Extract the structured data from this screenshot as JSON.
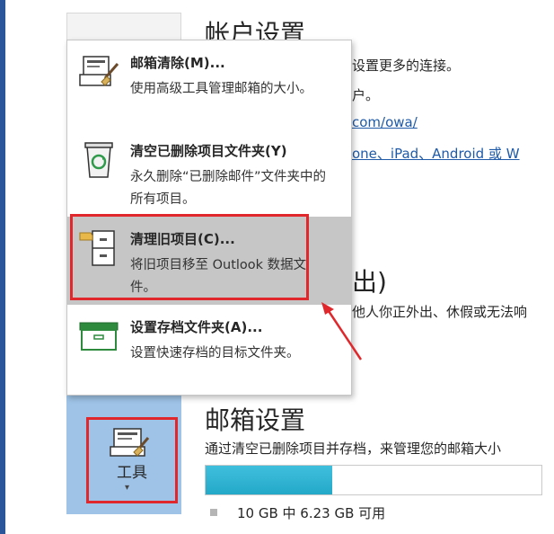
{
  "page": {
    "account_settings_title": "帐户设置",
    "account_lines": [
      "设置更多的连接。",
      "户。"
    ],
    "owa_link": "com/owa/",
    "devices_link": "one、iPad、Android 或 W",
    "auto_reply_title_fragment": "出)",
    "auto_reply_desc_fragment": "他人你正外出、休假或无法响",
    "mailbox_settings_title": "邮箱设置",
    "mailbox_settings_desc": "通过清空已删除项目并存档，来管理您的邮箱大小",
    "storage_text": "10 GB 中 6.23 GB 可用",
    "storage_fraction": 0.377,
    "tools_button_label": "工具"
  },
  "menu": {
    "items": [
      {
        "title": "邮箱清除(M)...",
        "desc": "使用高级工具管理邮箱的大小。",
        "icon": "mailbox-cleanup-icon"
      },
      {
        "title": "清空已删除项目文件夹(Y)",
        "desc": "永久删除“已删除邮件”文件夹中的所有项目。",
        "icon": "recycle-bin-icon"
      },
      {
        "title": "清理旧项目(C)...",
        "desc": "将旧项目移至 Outlook 数据文件。",
        "icon": "file-cabinet-icon"
      },
      {
        "title": "设置存档文件夹(A)...",
        "desc": "设置快速存档的目标文件夹。",
        "icon": "archive-box-icon"
      }
    ]
  },
  "colors": {
    "accent_blue": "#2b579a",
    "tools_tile": "#9ec3e6",
    "storage_fill": "#24a9c9",
    "annotation_red": "#e0282c",
    "menu_highlight": "#c6c6c6",
    "link": "#1e5aa8"
  }
}
